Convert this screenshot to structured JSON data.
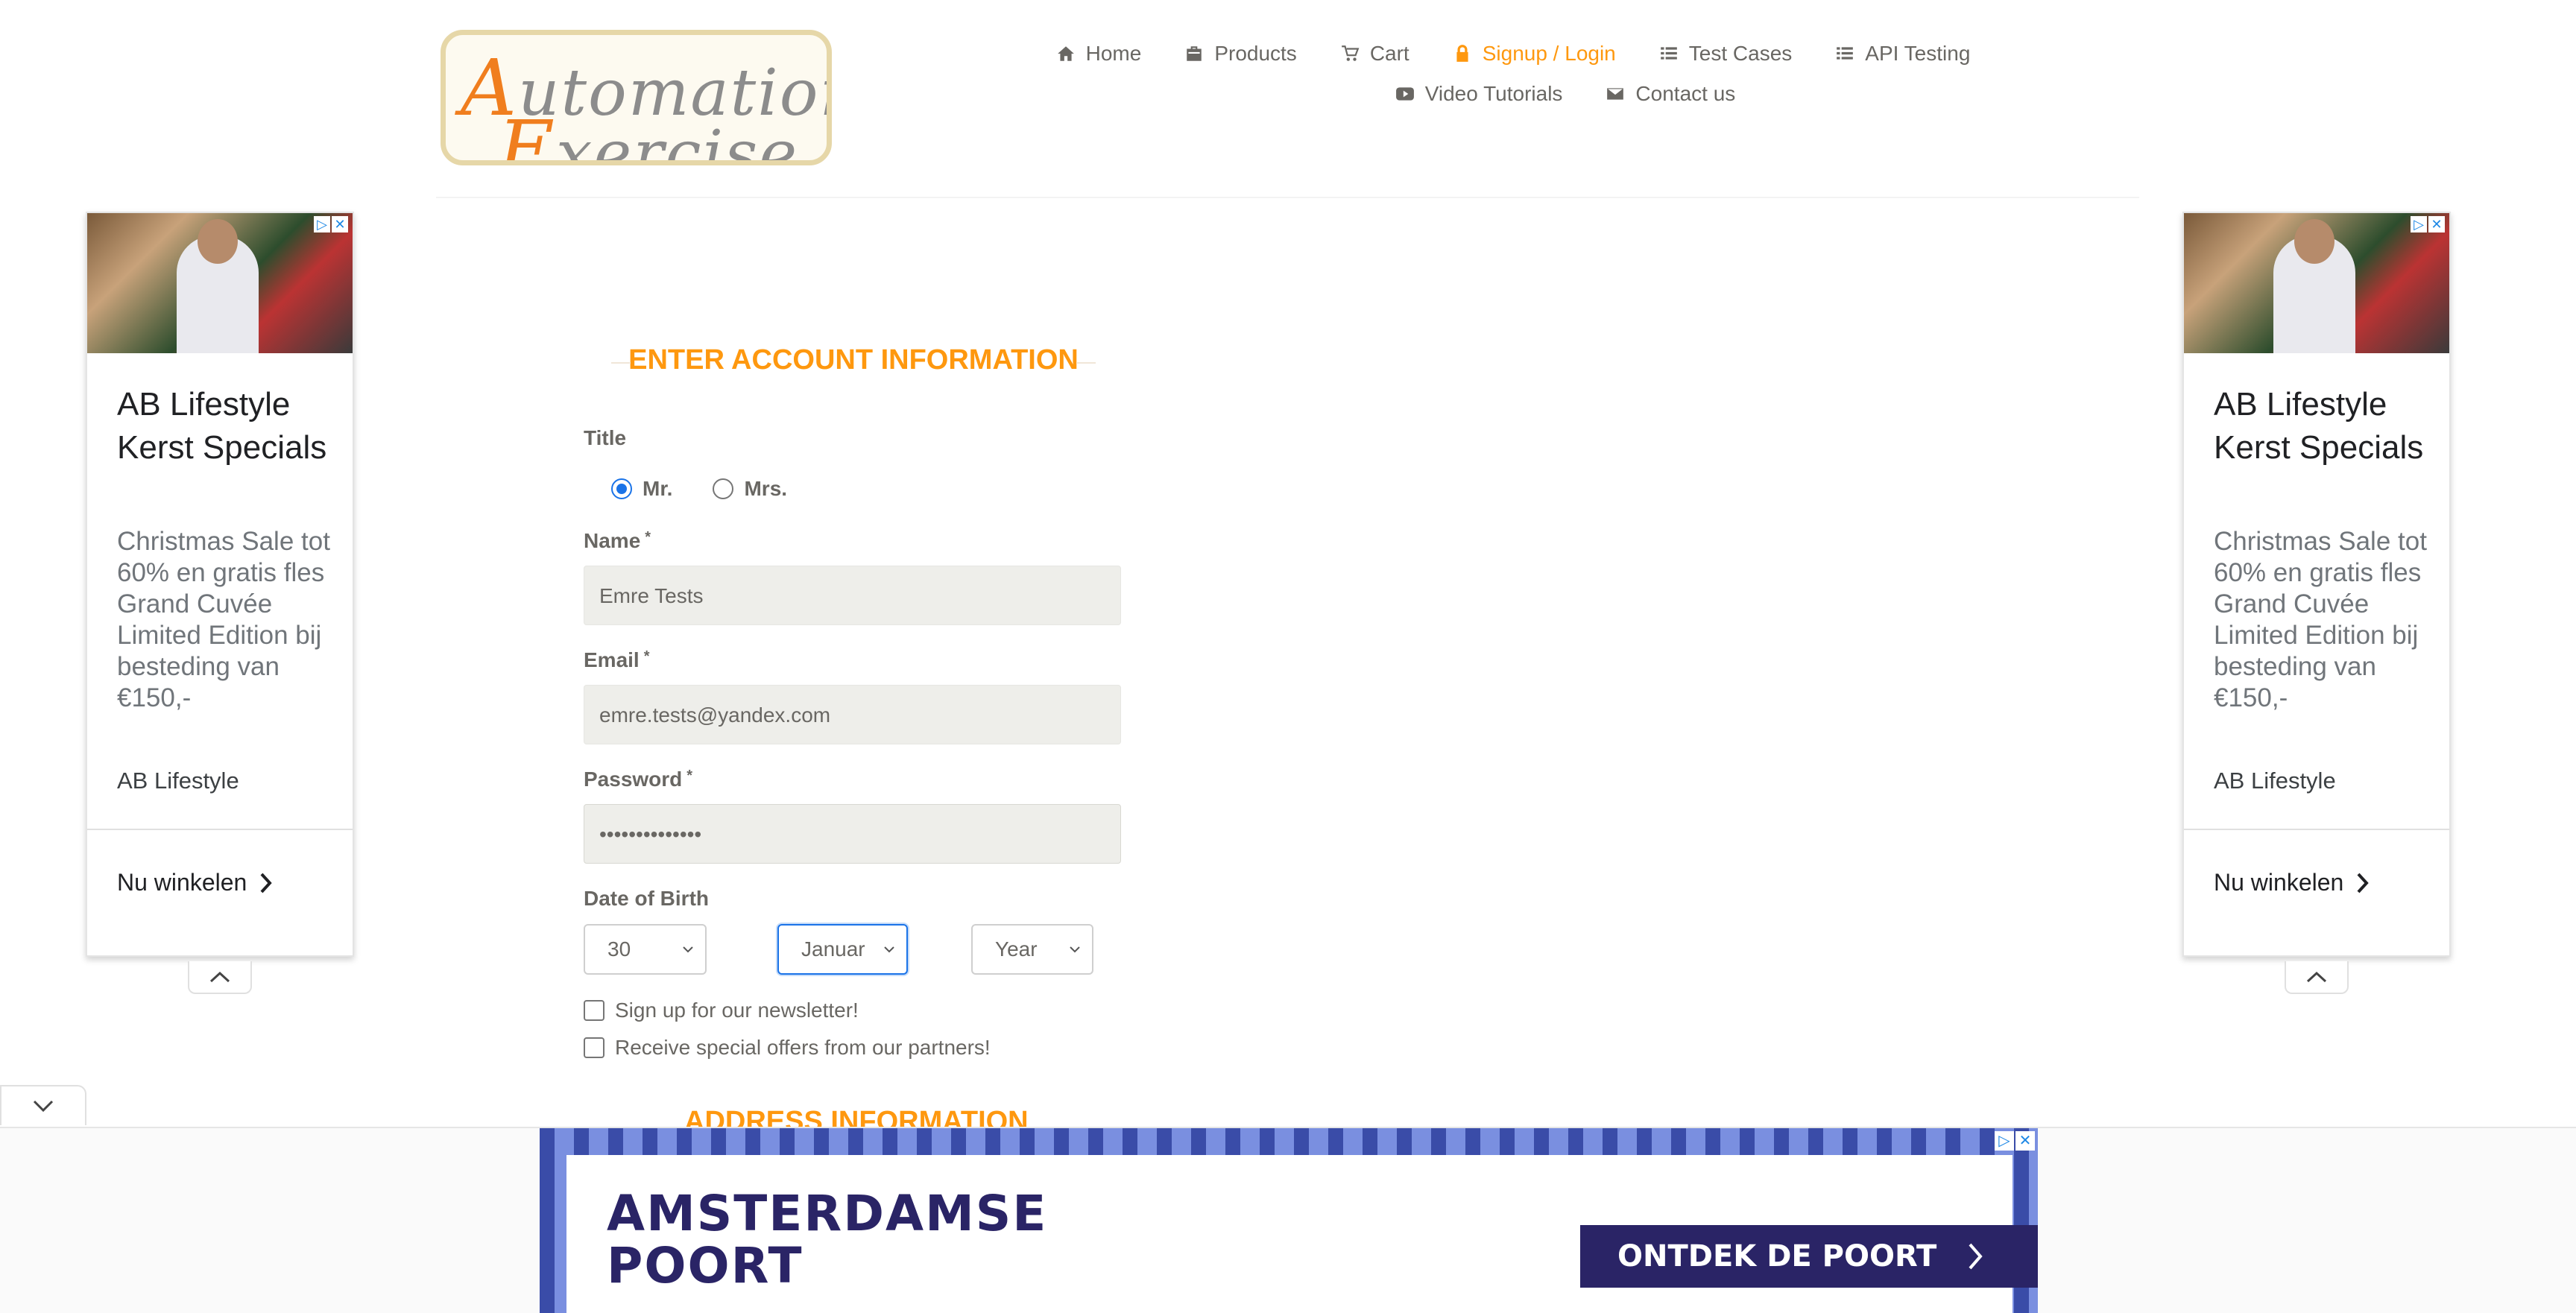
{
  "header": {
    "logo_line1": "Automation",
    "logo_line2": "Exercise",
    "nav": [
      {
        "label": "Home",
        "icon": "home-icon"
      },
      {
        "label": "Products",
        "icon": "products-icon"
      },
      {
        "label": "Cart",
        "icon": "cart-icon"
      },
      {
        "label": "Signup / Login",
        "icon": "lock-icon",
        "active": true
      },
      {
        "label": "Test Cases",
        "icon": "list-icon"
      },
      {
        "label": "API Testing",
        "icon": "list-icon"
      },
      {
        "label": "Video Tutorials",
        "icon": "youtube-icon"
      },
      {
        "label": "Contact us",
        "icon": "envelope-icon"
      }
    ]
  },
  "side_ad": {
    "title": "AB Lifestyle Kerst Specials",
    "description": "Christmas Sale tot 60% en gratis fles Grand Cuvée Limited Edition bij besteding van €150,-",
    "brand": "AB Lifestyle",
    "cta": "Nu winkelen"
  },
  "form": {
    "section_title": "ENTER ACCOUNT INFORMATION",
    "title_label": "Title",
    "title_options": [
      "Mr.",
      "Mrs."
    ],
    "title_selected": "Mr.",
    "name_label": "Name",
    "name_value": "Emre Tests",
    "email_label": "Email",
    "email_value": "emre.tests@yandex.com",
    "password_label": "Password",
    "password_value": "••••••••••••••",
    "required_mark": "*",
    "dob_label": "Date of Birth",
    "dob_day": "30",
    "dob_month": "Januar",
    "dob_year": "Year",
    "newsletter_label": "Sign up for our newsletter!",
    "offers_label": "Receive special offers from our partners!",
    "address_title": "ADDRESS INFORMATION"
  },
  "bottom_ad": {
    "brand_line1": "AMSTERDAMSE",
    "brand_line2": "POORT",
    "cta": "ONTDEK DE POORT"
  },
  "colors": {
    "accent": "#fe980f",
    "text": "#696763",
    "input_bg": "#eeeeea",
    "ad_blue": "#1a73e8",
    "banner_navy": "#2a2466"
  }
}
